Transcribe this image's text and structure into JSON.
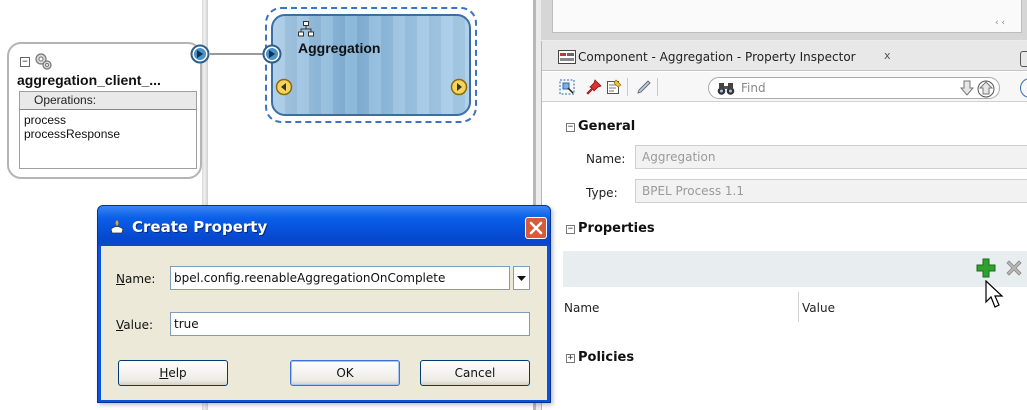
{
  "composite": {
    "service": {
      "name": "aggregation_client_...",
      "ops_header": "Operations:",
      "operations": [
        "process",
        "processResponse"
      ]
    },
    "bpel": {
      "name": "Aggregation"
    }
  },
  "inspector": {
    "tab_label": "Component - Aggregation - Property Inspector",
    "tab_close": "x",
    "find_placeholder": "Find",
    "scroll_arrows": "‹ ‹",
    "general": {
      "header": "General",
      "name_label": "Name:",
      "name_value": "Aggregation",
      "type_label": "Type:",
      "type_value": "BPEL Process 1.1"
    },
    "properties": {
      "header": "Properties",
      "columns": [
        "Name",
        "Value"
      ]
    },
    "policies": {
      "header": "Policies"
    }
  },
  "dialog": {
    "title": "Create Property",
    "name_label_u": "N",
    "name_label_rest": "ame:",
    "name_value": "bpel.config.reenableAggregationOnComplete",
    "value_label_u": "V",
    "value_label_rest": "alue:",
    "value_value": "true",
    "help_u": "H",
    "help_rest": "elp",
    "ok": "OK",
    "cancel": "Cancel"
  },
  "colors": {
    "dialog_title": "#0a53d8",
    "selection_border": "#3d72c8",
    "bpel_fill": "#7fb0d6",
    "add_icon": "#2fa12f"
  }
}
